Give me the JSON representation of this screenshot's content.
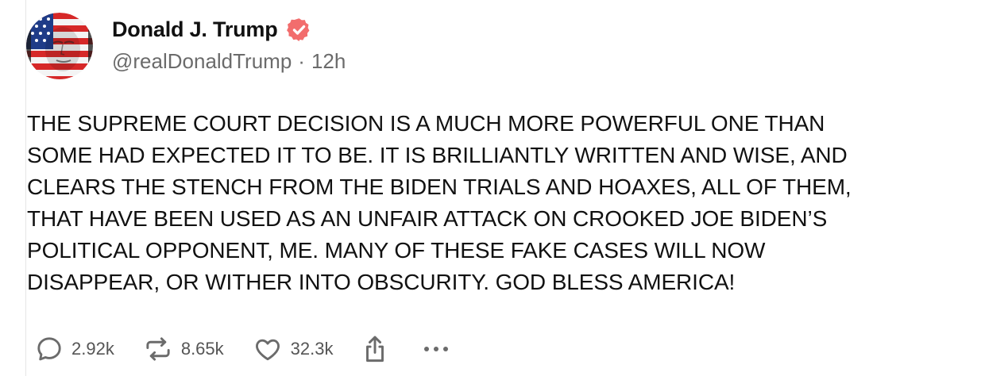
{
  "author": {
    "display_name": "Donald J. Trump",
    "handle": "@realDonaldTrump",
    "separator": "·",
    "time_ago": "12h",
    "verified_icon": "verified-badge-icon",
    "verified_color": "#f26d6d"
  },
  "post": {
    "lines": [
      "THE SUPREME COURT DECISION IS A MUCH MORE POWERFUL ONE THAN",
      "SOME HAD EXPECTED IT TO BE. IT IS BRILLIANTLY WRITTEN AND WISE, AND",
      "CLEARS THE STENCH FROM THE BIDEN TRIALS AND HOAXES, ALL OF THEM,",
      "THAT HAVE BEEN USED AS AN UNFAIR ATTACK ON CROOKED JOE BIDEN’S",
      "POLITICAL OPPONENT, ME. MANY OF THESE FAKE CASES WILL NOW",
      "DISAPPEAR, OR WITHER INTO OBSCURITY. GOD BLESS AMERICA!"
    ]
  },
  "actions": {
    "replies": {
      "icon": "reply-icon",
      "count": "2.92k"
    },
    "reposts": {
      "icon": "repost-icon",
      "count": "8.65k"
    },
    "likes": {
      "icon": "heart-icon",
      "count": "32.3k"
    },
    "share": {
      "icon": "share-icon"
    },
    "more": {
      "icon": "more-icon"
    }
  },
  "colors": {
    "icon_gray": "#6b6b6b",
    "text": "#111111",
    "meta": "#6b6b6b"
  }
}
